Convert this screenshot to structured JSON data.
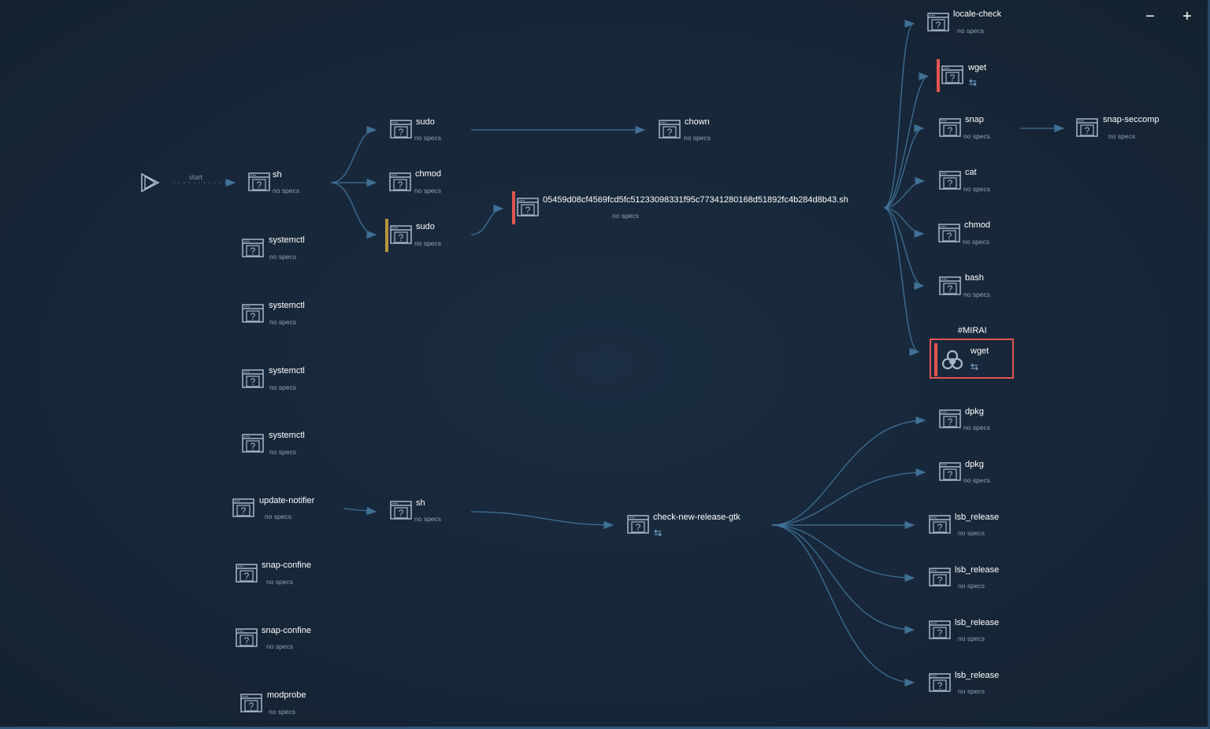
{
  "controls": {
    "zoom_out": "−",
    "zoom_in": "+"
  },
  "start": {
    "label": "start",
    "icon": "play-icon"
  },
  "colors": {
    "edge": "#3f7196",
    "warning_bar": "#b8963e",
    "danger_bar": "#e0564f",
    "highlight_border": "#e0564f"
  },
  "nodes": [
    {
      "label": "sh",
      "sub": "no specs"
    },
    {
      "label": "systemctl",
      "sub": "no specs"
    },
    {
      "label": "systemctl",
      "sub": "no specs"
    },
    {
      "label": "systemctl",
      "sub": "no specs"
    },
    {
      "label": "systemctl",
      "sub": "no specs"
    },
    {
      "label": "update-notifier",
      "sub": "no specs"
    },
    {
      "label": "snap-confine",
      "sub": "no specs"
    },
    {
      "label": "snap-confine",
      "sub": "no specs"
    },
    {
      "label": "modprobe",
      "sub": "no specs"
    },
    {
      "label": "sudo",
      "sub": "no specs"
    },
    {
      "label": "chmod",
      "sub": "no specs"
    },
    {
      "label": "sudo",
      "sub": "no specs",
      "bar": "warning"
    },
    {
      "label": "sh",
      "sub": "no specs"
    },
    {
      "label": "chown",
      "sub": "no specs"
    },
    {
      "label": "05459d08cf4569fcd5fc51233098331f95c77341280168d51892fc4b284d8b43.sh",
      "sub": "no specs",
      "bar": "danger"
    },
    {
      "label": "check-new-release-gtk",
      "sub": "⇆",
      "network": true
    },
    {
      "label": "locale-check",
      "sub": "no specs"
    },
    {
      "label": "wget",
      "sub": "⇆",
      "network": true,
      "bar": "danger"
    },
    {
      "label": "snap",
      "sub": "no specs"
    },
    {
      "label": "snap-seccomp",
      "sub": "no specs"
    },
    {
      "label": "cat",
      "sub": "no specs"
    },
    {
      "label": "chmod",
      "sub": "no specs"
    },
    {
      "label": "bash",
      "sub": "no specs"
    },
    {
      "label": "wget",
      "sub": "⇆",
      "network": true,
      "bar": "danger",
      "tag": "#MIRAI",
      "icon": "biohazard-icon"
    },
    {
      "label": "dpkg",
      "sub": "no specs"
    },
    {
      "label": "dpkg",
      "sub": "no specs"
    },
    {
      "label": "lsb_release",
      "sub": "no specs"
    },
    {
      "label": "lsb_release",
      "sub": "no specs"
    },
    {
      "label": "lsb_release",
      "sub": "no specs"
    },
    {
      "label": "lsb_release",
      "sub": "no specs"
    }
  ]
}
